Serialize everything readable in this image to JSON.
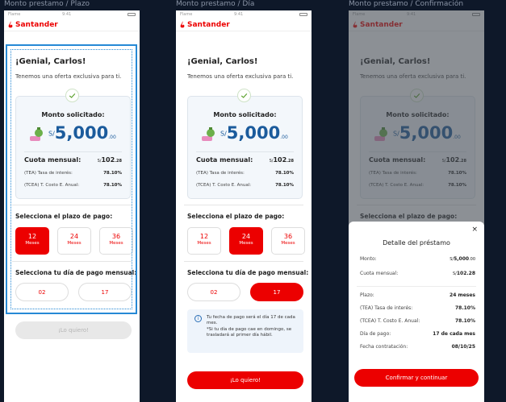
{
  "frames": [
    {
      "label": "Monto prestamo / Plazo"
    },
    {
      "label": "Monto prestamo / Día"
    },
    {
      "label": "Monto prestamo / Confirmación"
    }
  ],
  "status": {
    "carrier": "Flame",
    "time": "9:41"
  },
  "brand": {
    "name": "Santander"
  },
  "greeting": {
    "title": "¡Genial, Carlos!",
    "subtitle": "Tenemos una oferta exclusiva para ti."
  },
  "loan": {
    "title": "Monto solicitado:",
    "currency": "S/",
    "amount": "5,000",
    "decimals": ".00",
    "cuota_label": "Cuota mensual:",
    "cuota_currency": "S/",
    "cuota_amount": "102",
    "cuota_decimals": ".28",
    "tea_label": "(TEA) Tasa de interés:",
    "tea_value": "78.10%",
    "tcea_label": "(TCEA) T. Costo E. Anual:",
    "tcea_value": "78.10%"
  },
  "plazo": {
    "label": "Selecciona el plazo de pago:",
    "options": [
      {
        "n": "12",
        "unit": "Meses"
      },
      {
        "n": "24",
        "unit": "Meses"
      },
      {
        "n": "36",
        "unit": "Meses"
      }
    ]
  },
  "dia": {
    "label": "Selecciona tu día de pago mensual:",
    "options": [
      "02",
      "17"
    ]
  },
  "cta": {
    "label": "¡Lo quiero!"
  },
  "info": {
    "line1": "Tu fecha de pago será el día 17 de cada mes.",
    "line2": "*Si tu día de pago cae en domingo, se trasladará al primer día hábil."
  },
  "detail": {
    "title": "Detalle del préstamo",
    "close": "×",
    "monto_label": "Monto:",
    "monto_cur": "S/",
    "monto_value": "5,000",
    "monto_dec": ".00",
    "cuota_label": "Cuota mensual:",
    "cuota_cur": "S/",
    "cuota_value": "102.28",
    "plazo_label": "Plazo:",
    "plazo_value": "24 meses",
    "tea_label": "(TEA) Tasa de interés:",
    "tea_value": "78.10%",
    "tcea_label": "(TCEA) T. Costo E. Anual:",
    "tcea_value": "78.10%",
    "dia_label": "Día de pago:",
    "dia_value": "17 de cada mes",
    "fecha_label": "Fecha contratación:",
    "fecha_value": "08/10/25",
    "button": "Confirmar y continuar"
  },
  "colors": {
    "brand_red": "#ec0000",
    "amount_blue": "#1b5b9c",
    "focus_blue": "#2689d5",
    "canvas": "#0e1829"
  },
  "icons": [
    "flame-icon",
    "check-icon",
    "money-bag-icon",
    "battery-icon",
    "info-icon",
    "close-icon"
  ]
}
